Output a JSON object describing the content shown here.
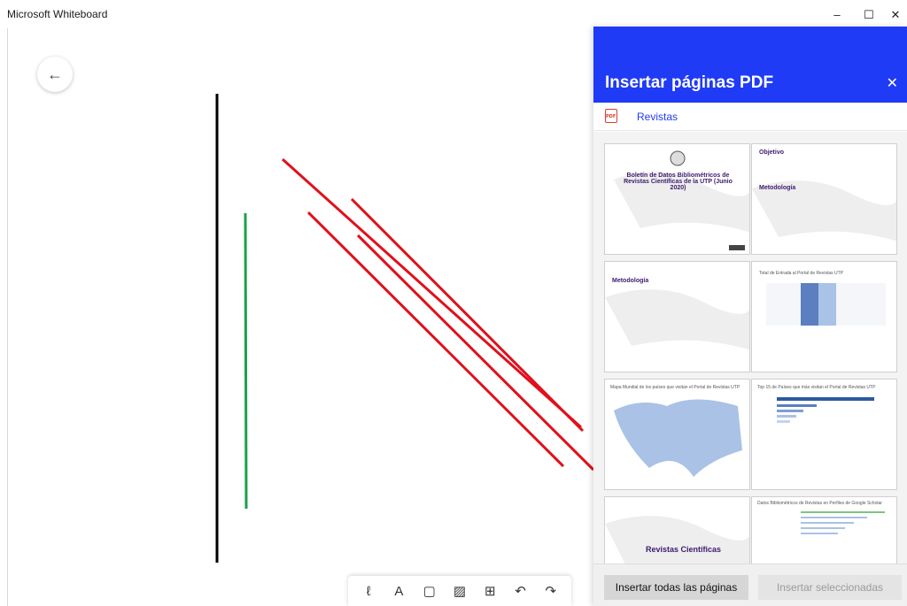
{
  "window": {
    "title": "Microsoft Whiteboard",
    "minimize_glyph": "–",
    "maximize_glyph": "☐",
    "close_glyph": "✕"
  },
  "canvas": {
    "back_glyph": "←"
  },
  "toolbar": {
    "tools": [
      {
        "name": "pen",
        "glyph": "ℓ"
      },
      {
        "name": "text",
        "glyph": "A"
      },
      {
        "name": "note",
        "glyph": "▢"
      },
      {
        "name": "image",
        "glyph": "▨"
      },
      {
        "name": "insert",
        "glyph": "⊞"
      },
      {
        "name": "undo",
        "glyph": "↶"
      },
      {
        "name": "redo",
        "glyph": "↷"
      }
    ]
  },
  "panel": {
    "title": "Insertar páginas PDF",
    "close_glyph": "✕",
    "file_icon_label": "PDF",
    "file_name": "Revistas",
    "pages": [
      {
        "title": "Boletín de Datos Bibliométricos de Revistas Científicas de la UTP (Junio 2020)"
      },
      {
        "title": "Objetivo",
        "subtitle": "Metodología"
      },
      {
        "title": "Metodología"
      },
      {
        "title": "Total de Entrada al Portal de Revistas UTP"
      },
      {
        "title": "Mapa Mundial de los países que visitan el Portal de Revistas UTP"
      },
      {
        "title": "Top 15 de Países que más visitan el Portal de Revistas UTP"
      },
      {
        "title": "Revistas Científicas"
      },
      {
        "title": "Datos Bibliométricos de Revistas en Perfiles de Google Scholar"
      }
    ],
    "insert_all_label": "Insertar todas las páginas",
    "insert_selected_label": "Insertar seleccionadas"
  },
  "colors": {
    "header_blue": "#1f3bf5",
    "ink_black": "#000000",
    "ink_green": "#1aa04a",
    "ink_red": "#e0101a"
  }
}
